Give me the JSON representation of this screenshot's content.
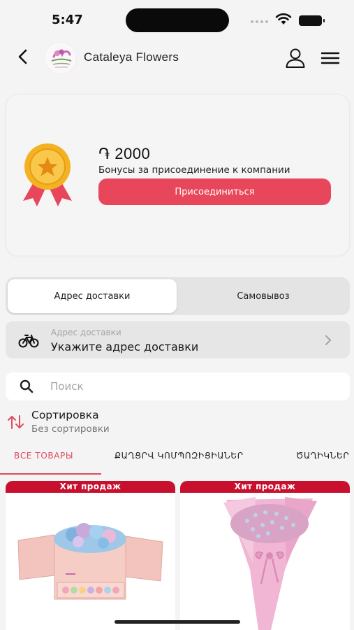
{
  "status_bar": {
    "time": "5:47"
  },
  "header": {
    "title": "Cataleya Flowers"
  },
  "bonus": {
    "amount": "֏ 2000",
    "description": "Бонусы за присоединение к компании",
    "join_label": "Присоединиться"
  },
  "delivery_tabs": [
    {
      "label": "Адрес доставки",
      "active": true
    },
    {
      "label": "Самовывоз",
      "active": false
    }
  ],
  "address": {
    "label": "Адрес доставки",
    "value": "Укажите адрес доставки"
  },
  "search": {
    "placeholder": "Поиск"
  },
  "sort": {
    "title": "Сортировка",
    "subtitle": "Без сортировки"
  },
  "categories": [
    {
      "label": "ВСЕ ТОВАРЫ",
      "active": true
    },
    {
      "label": "ՔԱՂՑՐՎ ԿՈՄՊՈԶԻՑԻԱՆԵՐ",
      "active": false
    },
    {
      "label": "ԾԱՂԻԿՆԵՐ",
      "active": false
    }
  ],
  "products": [
    {
      "badge": "Хит продаж",
      "image": "pink-gift-box-with-flowers-and-macarons"
    },
    {
      "badge": "Хит продаж",
      "image": "pink-gypsophila-bouquet"
    }
  ],
  "colors": {
    "accent": "#e8475b",
    "badge": "#c8102e",
    "medal_gold": "#f4b223",
    "medal_ribbon": "#e8475b"
  }
}
